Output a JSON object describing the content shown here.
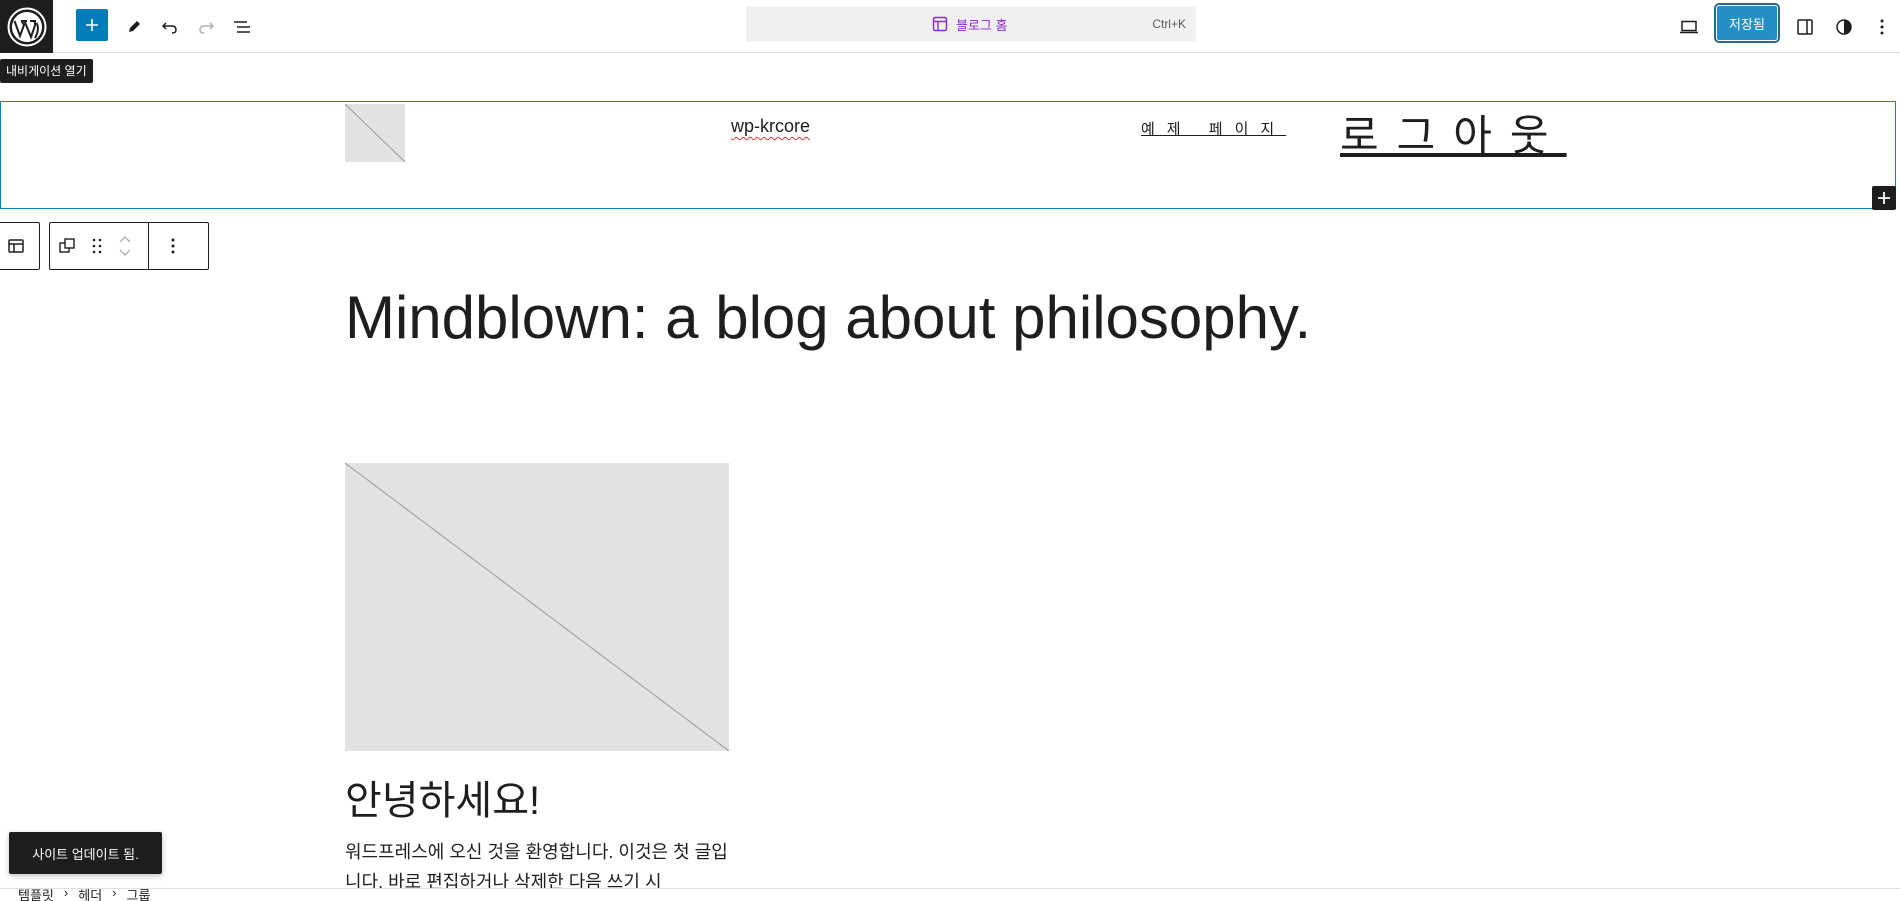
{
  "topbar": {
    "wp_logo_icon": "wordpress-logo-icon",
    "add_block_icon": "plus-icon",
    "tools_icon": "pencil-icon",
    "undo_icon": "undo-icon",
    "redo_icon": "redo-icon",
    "document_overview_icon": "list-view-icon",
    "command": {
      "icon": "layout-icon",
      "title": "블로그 홈",
      "shortcut": "Ctrl+K"
    },
    "view_icon": "desktop-icon",
    "save_label": "저장됨",
    "settings_icon": "sidebar-icon",
    "styles_icon": "contrast-icon",
    "options_icon": "more-vertical-icon",
    "accent_color": "#007cba"
  },
  "tooltip": {
    "text": "내비게이션 열기"
  },
  "header": {
    "site_title": "wp-krcore",
    "nav": [
      "예제 페이지",
      "로그아웃"
    ]
  },
  "block_toolbar": {
    "icons": [
      "template-part-icon",
      "transform-icon",
      "drag-handle-icon",
      "move-up-icon",
      "move-down-icon",
      "more-options-icon"
    ]
  },
  "content": {
    "heading": "Mindblown: a blog about philosophy.",
    "post": {
      "title": "안녕하세요!",
      "excerpt": "워드프레스에 오신 것을 환영합니다. 이것은 첫 글입니다. 바로 편집하거나 삭제한 다음 쓰기 시"
    }
  },
  "snackbar": {
    "text": "사이트 업데이트 됨."
  },
  "breadcrumb": [
    "템플릿",
    "헤더",
    "그룹"
  ]
}
